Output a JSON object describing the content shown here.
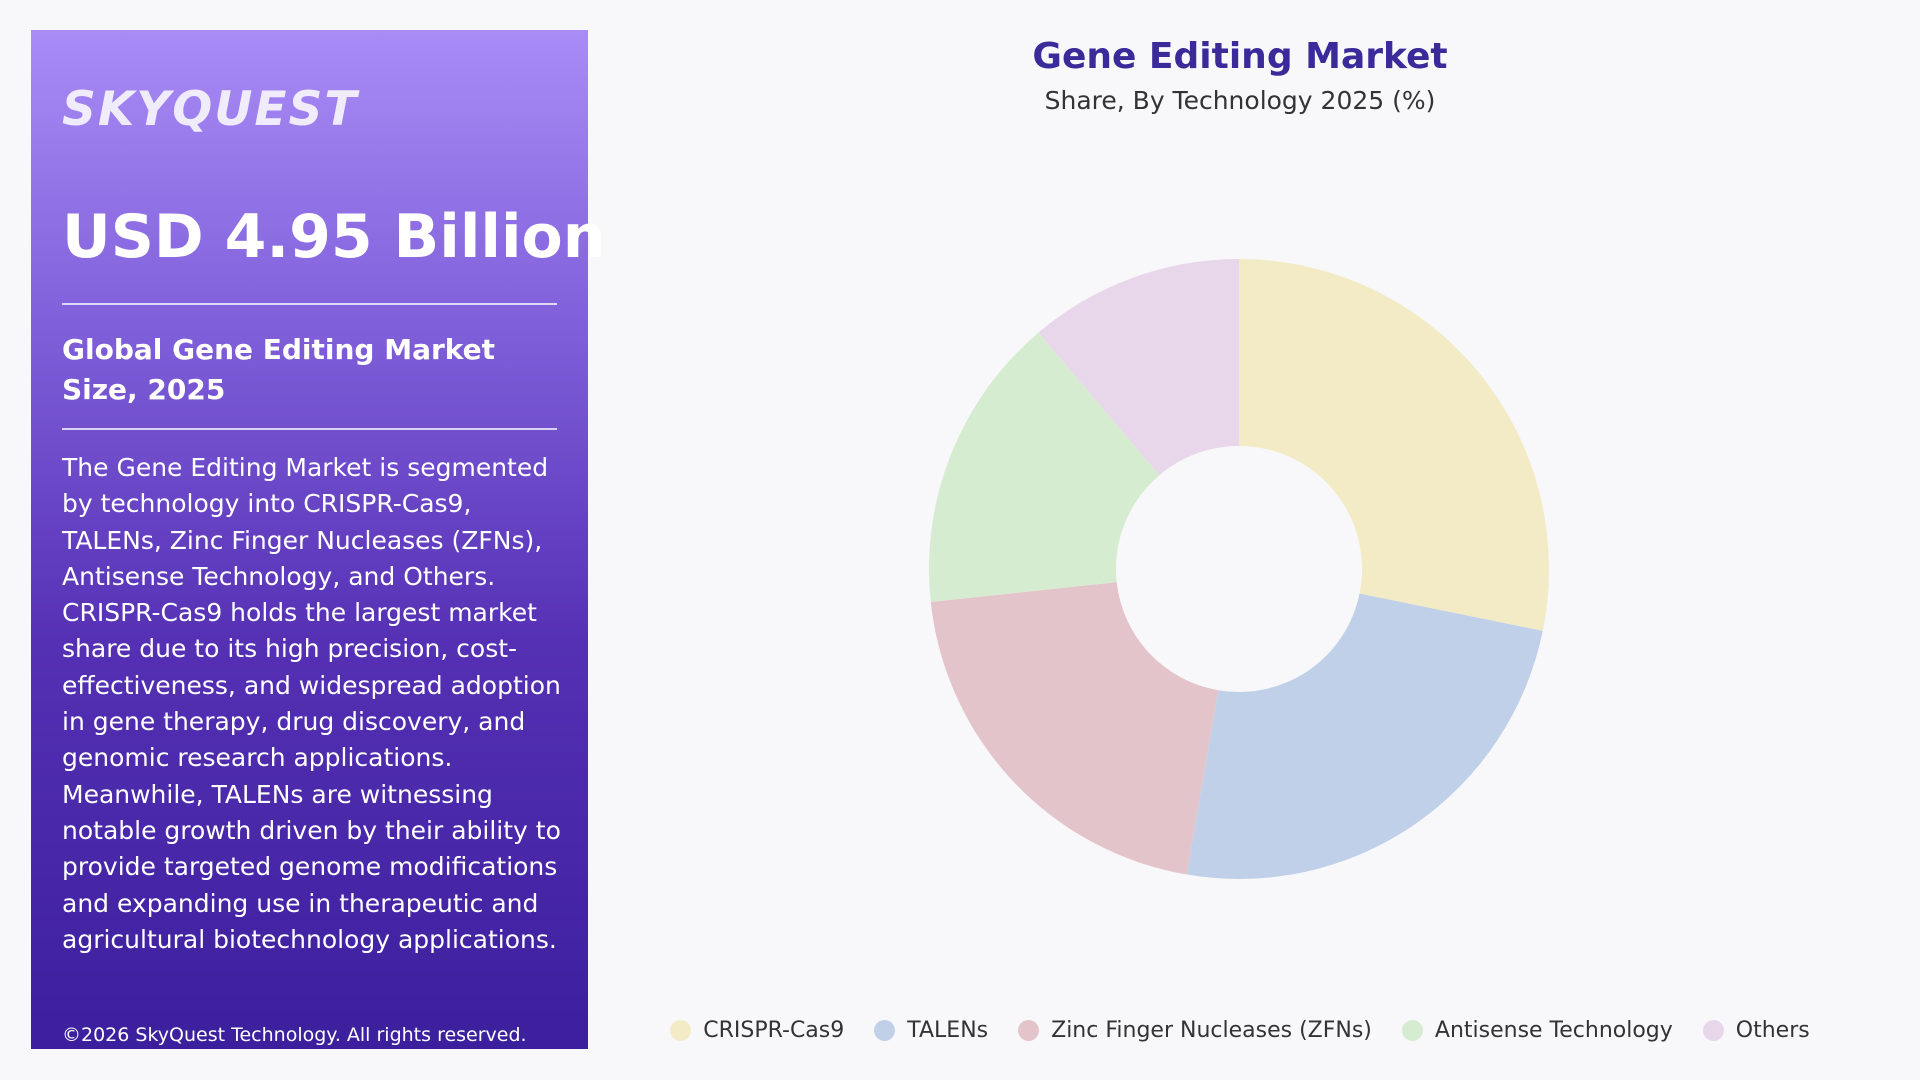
{
  "panel": {
    "logo": "SKYQUEST",
    "market_value": "USD 4.95 Billion",
    "market_size_label": "Global Gene Editing Market Size, 2025",
    "description": "The Gene Editing Market is segmented by technology into CRISPR-Cas9, TALENs, Zinc Finger Nucleases (ZFNs), Antisense Technology, and Others. CRISPR-Cas9 holds the largest market share due to its high precision, cost-effectiveness, and widespread adoption in gene therapy, drug discovery, and genomic research applications. Meanwhile, TALENs are witnessing notable growth driven by their ability to provide targeted genome modifications and expanding use in therapeutic and agricultural biotechnology applications.",
    "copyright": "©2026 SkyQuest Technology. All rights reserved."
  },
  "chart_data": {
    "type": "pie",
    "title": "Gene Editing Market",
    "subtitle": "Share, By Technology 2025 (%)",
    "donut": true,
    "legend_position": "bottom",
    "categories": [
      "CRISPR-Cas9",
      "TALENs",
      "Zinc Finger Nucleases (ZFNs)",
      "Antisense Technology",
      "Others"
    ],
    "values": [
      28.2,
      24.5,
      20.6,
      15.5,
      11.2
    ],
    "colors": [
      "#f3ebc6",
      "#c0d0e8",
      "#e3c4ca",
      "#d6ecd0",
      "#e8d6ea"
    ]
  }
}
